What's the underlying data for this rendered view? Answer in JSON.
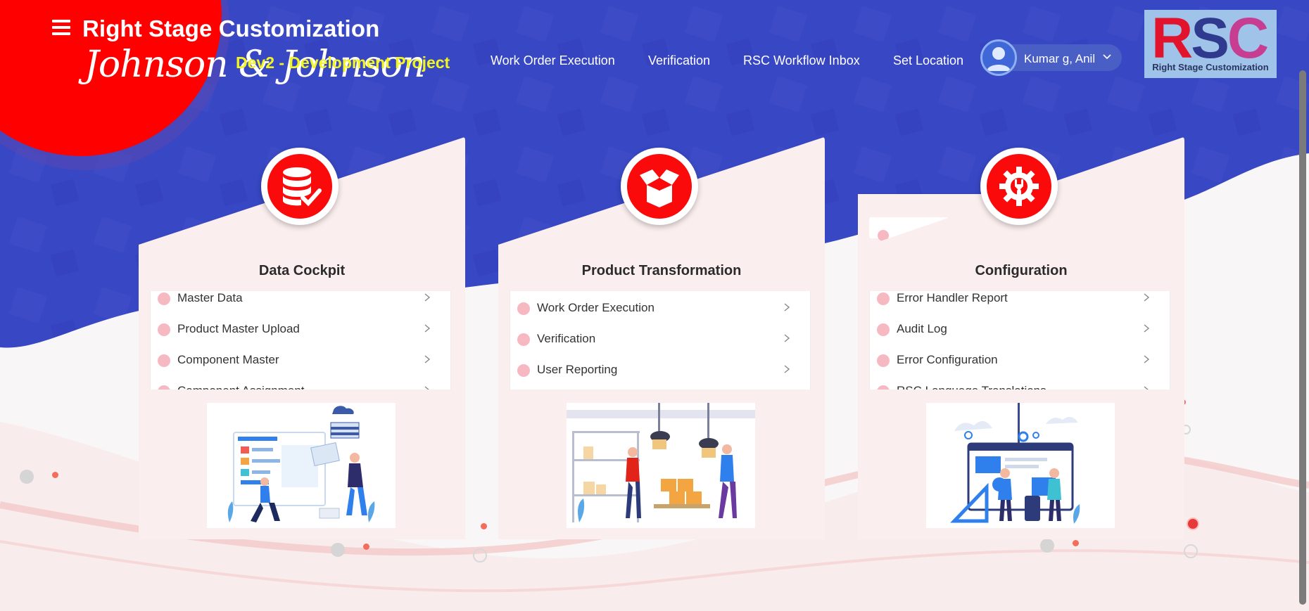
{
  "header": {
    "app_title": "Right Stage Customization",
    "brand": "Johnson & Johnson",
    "project": "Dev2 - Development Project",
    "nav": [
      {
        "label": "Work Order Execution"
      },
      {
        "label": "Verification"
      },
      {
        "label": "RSC Workflow Inbox"
      },
      {
        "label": "Set Location"
      }
    ],
    "user": {
      "name": "Kumar g, Anil"
    },
    "logo": {
      "letters": [
        "R",
        "S",
        "C"
      ],
      "subtitle": "Right Stage Customization"
    }
  },
  "cards": [
    {
      "title": "Data Cockpit",
      "icon": "database-check-icon",
      "items": [
        {
          "label": "Master Data"
        },
        {
          "label": "Product Master Upload"
        },
        {
          "label": "Component Master"
        },
        {
          "label": "Component Assignment"
        }
      ]
    },
    {
      "title": "Product Transformation",
      "icon": "open-box-icon",
      "items": [
        {
          "label": "Work Order Execution"
        },
        {
          "label": "Verification"
        },
        {
          "label": "User Reporting"
        }
      ]
    },
    {
      "title": "Configuration",
      "icon": "gear-wrench-icon",
      "items": [
        {
          "label": "Error Handler Report"
        },
        {
          "label": "Audit Log"
        },
        {
          "label": "Error Configuration"
        },
        {
          "label": "RSC Language Translations"
        }
      ]
    }
  ],
  "colors": {
    "banner_blue": "#3847c3",
    "brand_red": "#fa0a0a",
    "project_yellow": "#f3f61e",
    "card_bg": "#fbeeee",
    "bullet_pink": "#f7b9c1"
  }
}
